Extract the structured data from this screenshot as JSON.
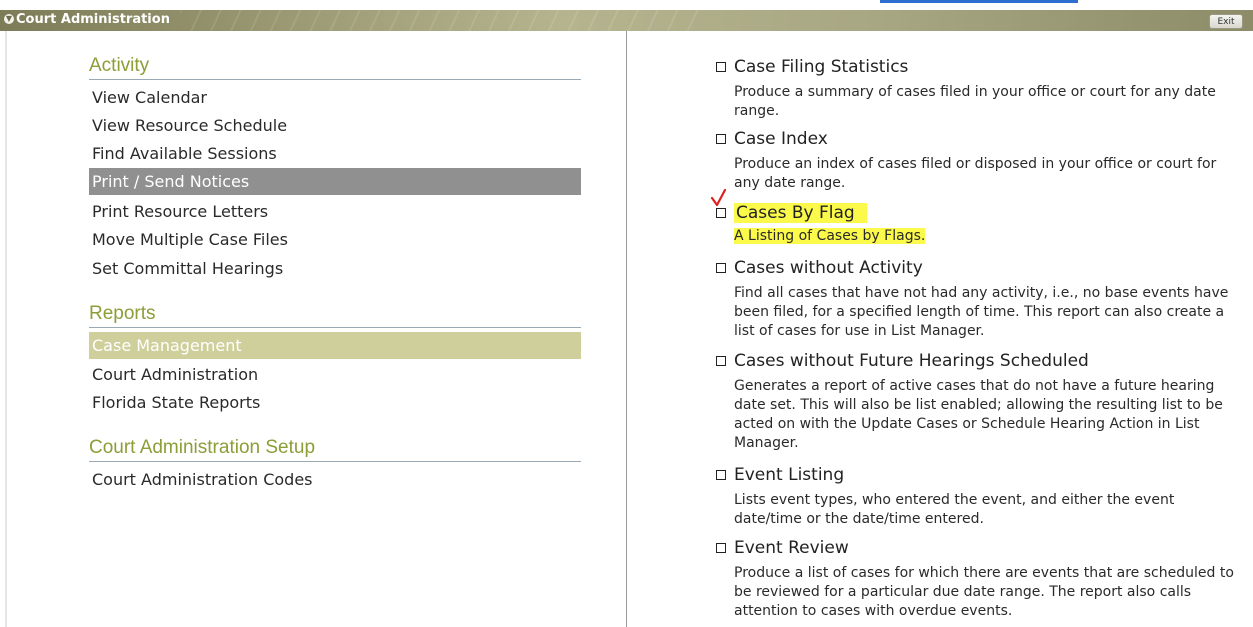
{
  "app": {
    "title": "Court Administration",
    "title_icon": "collapse-arrow-icon",
    "exit_label": "Exit"
  },
  "sections": [
    {
      "heading": "Activity",
      "items": [
        {
          "label": "View Calendar"
        },
        {
          "label": "View Resource Schedule"
        },
        {
          "label": "Find Available Sessions"
        },
        {
          "label": "Print / Send Notices",
          "state": "selected"
        },
        {
          "label": "Print Resource Letters"
        },
        {
          "label": "Move Multiple Case Files"
        },
        {
          "label": "Set Committal Hearings"
        }
      ]
    },
    {
      "heading": "Reports",
      "items": [
        {
          "label": "Case Management",
          "state": "active"
        },
        {
          "label": "Court Administration"
        },
        {
          "label": "Florida State Reports"
        }
      ]
    },
    {
      "heading": "Court Administration Setup",
      "items": [
        {
          "label": "Court Administration Codes"
        }
      ]
    }
  ],
  "reports": [
    {
      "title": "Case Filing Statistics",
      "description": "Produce a summary of cases filed in your office or court for any date range."
    },
    {
      "title": "Case Index",
      "description": "Produce an index of cases filed or disposed in your office or court for any date range."
    },
    {
      "title": "Cases By Flag",
      "description": "A Listing of Cases by Flags.",
      "annotated": true
    },
    {
      "title": "Cases without Activity",
      "description": "Find all cases that have not had any activity, i.e., no base events have been filed, for a specified length of time. This report can also create a list of cases for use in List Manager."
    },
    {
      "title": "Cases without Future Hearings Scheduled",
      "description": "Generates a report of active cases that do not have a future hearing date set. This will also be list enabled; allowing the resulting list to be acted on with the Update Cases or Schedule Hearing Action in List Manager."
    },
    {
      "title": "Event Listing",
      "description": "Lists event types, who entered the event, and either the event date/time or the date/time entered."
    },
    {
      "title": "Event Review",
      "description": "Produce a list of cases for which there are events that are scheduled to be reviewed for a particular due date range. The report also calls attention to cases with overdue events."
    }
  ],
  "colors": {
    "heading": "#8b9e37",
    "selected_item_bg": "#909090",
    "active_item_bg": "#cfcf9c",
    "highlight": "#fbf94a",
    "annotation_check": "#e02020"
  }
}
